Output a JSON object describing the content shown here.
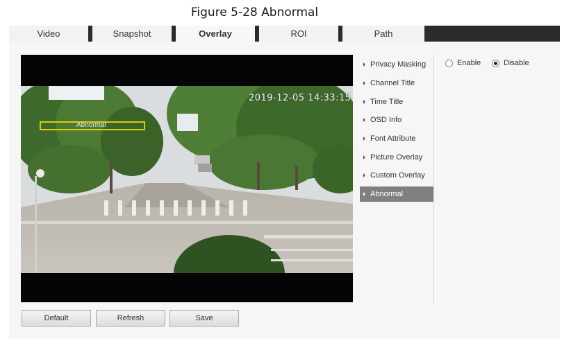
{
  "caption": "Figure 5-28 Abnormal",
  "tabs": [
    {
      "label": "Video"
    },
    {
      "label": "Snapshot"
    },
    {
      "label": "Overlay"
    },
    {
      "label": "ROI"
    },
    {
      "label": "Path"
    }
  ],
  "active_tab": "Overlay",
  "video": {
    "timestamp": "2019-12-05 14:33:15",
    "abnormal_label": "Abnormal"
  },
  "menu": {
    "items": [
      {
        "label": "Privacy Masking"
      },
      {
        "label": "Channel Title"
      },
      {
        "label": "Time Title"
      },
      {
        "label": "OSD Info"
      },
      {
        "label": "Font Attribute"
      },
      {
        "label": "Picture Overlay"
      },
      {
        "label": "Custom Overlay"
      },
      {
        "label": "Abnormal"
      }
    ],
    "selected": "Abnormal"
  },
  "privacy": {
    "enable_label": "Enable",
    "disable_label": "Disable",
    "selected": "Disable"
  },
  "buttons": {
    "default_label": "Default",
    "refresh_label": "Refresh",
    "save_label": "Save"
  },
  "colors": {
    "tab_bar": "#2b2b2b",
    "menu_selected": "#808080",
    "abnormal_box": "#d7d000"
  }
}
